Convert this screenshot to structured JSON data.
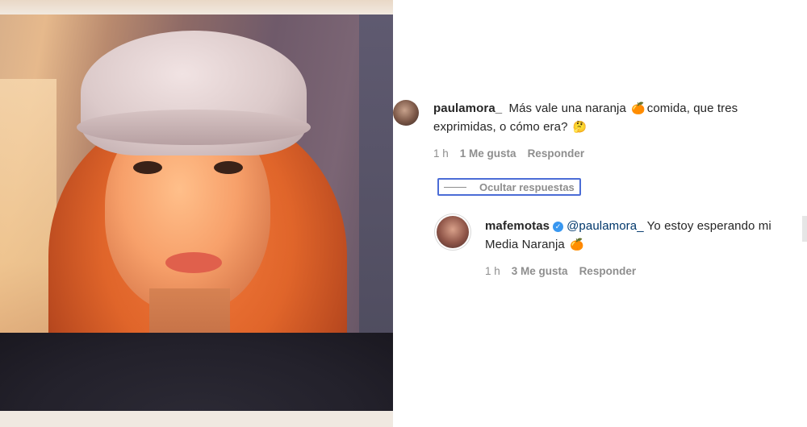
{
  "photo": {
    "alt": ""
  },
  "comments": [
    {
      "username": "paulamora_",
      "text_part1": "Más vale una naranja",
      "emoji1": "🍊",
      "text_part2": "comida, que tres",
      "text_line2": "exprimidas, o cómo era?",
      "emoji2": "🤔",
      "time": "1 h",
      "likes": "1 Me gusta",
      "reply": "Responder"
    }
  ],
  "hide_replies_label": "Ocultar respuestas",
  "reply": {
    "username": "mafemotas",
    "mention": "@paulamora_",
    "text_part1": "Yo estoy esperando mi",
    "text_line2": "Media Naranja",
    "emoji": "🍊",
    "time": "1 h",
    "likes": "3 Me gusta",
    "reply": "Responder"
  },
  "colors": {
    "verified": "#3897f0",
    "mention": "#00376b",
    "meta": "#8e8e8e"
  }
}
